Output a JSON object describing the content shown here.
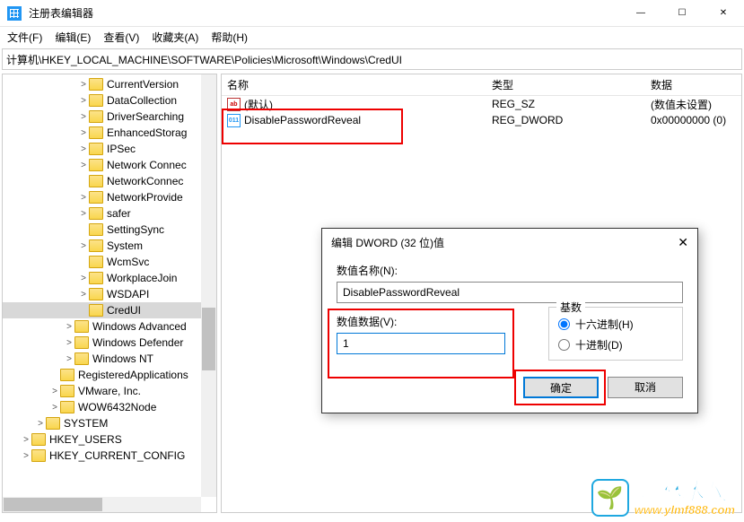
{
  "window": {
    "title": "注册表编辑器",
    "controls": {
      "min": "—",
      "max": "☐",
      "close": "✕"
    }
  },
  "menu": {
    "file": "文件(F)",
    "edit": "编辑(E)",
    "view": "查看(V)",
    "favorites": "收藏夹(A)",
    "help": "帮助(H)"
  },
  "address": "计算机\\HKEY_LOCAL_MACHINE\\SOFTWARE\\Policies\\Microsoft\\Windows\\CredUI",
  "tree": [
    {
      "indent": 84,
      "exp": ">",
      "label": "CurrentVersion"
    },
    {
      "indent": 84,
      "exp": ">",
      "label": "DataCollection"
    },
    {
      "indent": 84,
      "exp": ">",
      "label": "DriverSearching"
    },
    {
      "indent": 84,
      "exp": ">",
      "label": "EnhancedStorag"
    },
    {
      "indent": 84,
      "exp": ">",
      "label": "IPSec"
    },
    {
      "indent": 84,
      "exp": ">",
      "label": "Network Connec"
    },
    {
      "indent": 84,
      "exp": "",
      "label": "NetworkConnec"
    },
    {
      "indent": 84,
      "exp": ">",
      "label": "NetworkProvide"
    },
    {
      "indent": 84,
      "exp": ">",
      "label": "safer"
    },
    {
      "indent": 84,
      "exp": "",
      "label": "SettingSync"
    },
    {
      "indent": 84,
      "exp": ">",
      "label": "System"
    },
    {
      "indent": 84,
      "exp": "",
      "label": "WcmSvc"
    },
    {
      "indent": 84,
      "exp": ">",
      "label": "WorkplaceJoin"
    },
    {
      "indent": 84,
      "exp": ">",
      "label": "WSDAPI"
    },
    {
      "indent": 84,
      "exp": "",
      "label": "CredUI",
      "selected": true
    },
    {
      "indent": 68,
      "exp": ">",
      "label": "Windows Advanced"
    },
    {
      "indent": 68,
      "exp": ">",
      "label": "Windows Defender"
    },
    {
      "indent": 68,
      "exp": ">",
      "label": "Windows NT"
    },
    {
      "indent": 52,
      "exp": "",
      "label": "RegisteredApplications"
    },
    {
      "indent": 52,
      "exp": ">",
      "label": "VMware, Inc."
    },
    {
      "indent": 52,
      "exp": ">",
      "label": "WOW6432Node"
    },
    {
      "indent": 36,
      "exp": ">",
      "label": "SYSTEM"
    },
    {
      "indent": 20,
      "exp": ">",
      "label": "HKEY_USERS"
    },
    {
      "indent": 20,
      "exp": ">",
      "label": "HKEY_CURRENT_CONFIG"
    }
  ],
  "list": {
    "headers": {
      "name": "名称",
      "type": "类型",
      "data": "数据"
    },
    "rows": [
      {
        "icon": "string",
        "name": "(默认)",
        "type": "REG_SZ",
        "data": "(数值未设置)"
      },
      {
        "icon": "dword",
        "name": "DisablePasswordReveal",
        "type": "REG_DWORD",
        "data": "0x00000000 (0)"
      }
    ]
  },
  "dialog": {
    "title": "编辑 DWORD (32 位)值",
    "name_label": "数值名称(N):",
    "name_value": "DisablePasswordReveal",
    "value_label": "数值数据(V):",
    "value_input": "1",
    "base_label": "基数",
    "radio_hex": "十六进制(H)",
    "radio_dec": "十进制(D)",
    "ok": "确定",
    "cancel": "取消"
  },
  "watermark": {
    "brand": "雨林木风",
    "url": "www.ylmf888.com",
    "emoji": "🌱"
  }
}
